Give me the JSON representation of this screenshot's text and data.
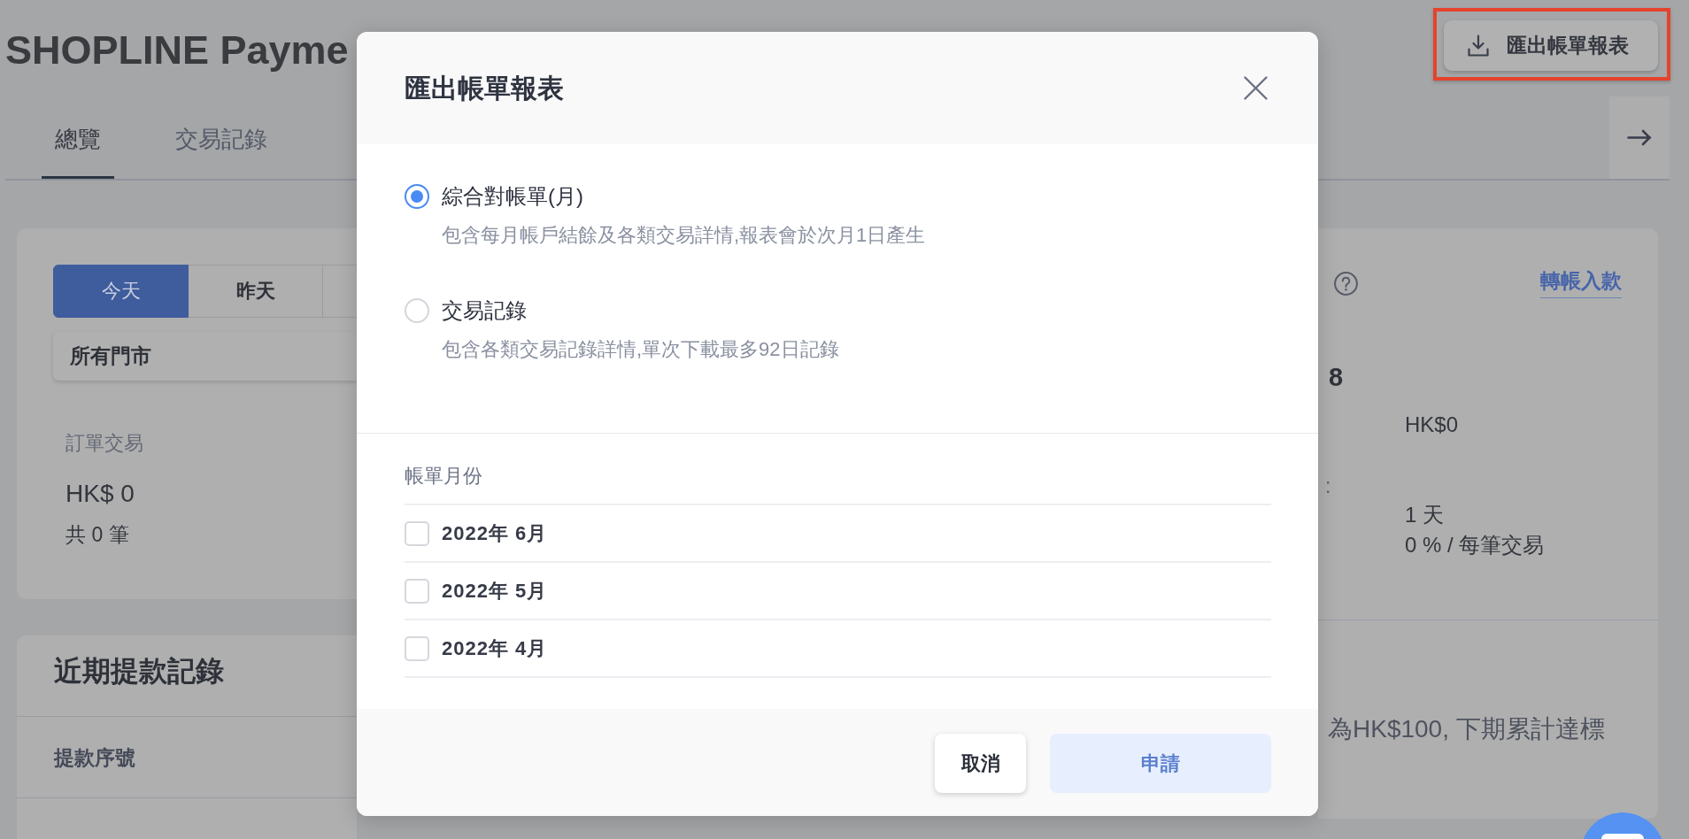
{
  "header": {
    "title": "SHOPLINE Payme",
    "export_button": {
      "label": "匯出帳單報表",
      "highlighted": true
    }
  },
  "tabs": [
    {
      "label": "總覽",
      "selected": true
    },
    {
      "label": "交易記錄",
      "selected": false
    }
  ],
  "summary_card": {
    "periods": [
      {
        "label": "今天",
        "selected": true
      },
      {
        "label": "昨天",
        "selected": false
      },
      {
        "selected": false
      }
    ],
    "store_select": {
      "value": "所有門市"
    },
    "metric": {
      "label": "訂單交易",
      "amount": "HK$ 0",
      "count": "共 0 筆"
    }
  },
  "withdrawals_card": {
    "title": "近期提款記錄",
    "columns": [
      "提款序號"
    ]
  },
  "balance_card": {
    "transfer_link": "轉帳入款",
    "balance_fragment": "8",
    "value_1": "HK$0",
    "label_fragment": ":",
    "value_2": "1 天",
    "value_3": "0 % / 每筆交易",
    "note_fragment": "為HK$100, 下期累計達標"
  },
  "dialog": {
    "title": "匯出帳單報表",
    "report_types": [
      {
        "label": "綜合對帳單(月)",
        "description": "包含每月帳戶結餘及各類交易詳情,報表會於次月1日產生",
        "selected": true
      },
      {
        "label": "交易記錄",
        "description": "包含各類交易記錄詳情,單次下載最多92日記錄",
        "selected": false
      }
    ],
    "month_label": "帳單月份",
    "months": [
      {
        "label": "2022年 6月",
        "checked": false
      },
      {
        "label": "2022年 5月",
        "checked": false
      },
      {
        "label": "2022年 4月",
        "checked": false
      }
    ],
    "buttons": [
      {
        "label": "取消",
        "kind": "secondary",
        "disabled": false
      },
      {
        "label": "申請",
        "kind": "primary",
        "disabled": true
      }
    ]
  }
}
